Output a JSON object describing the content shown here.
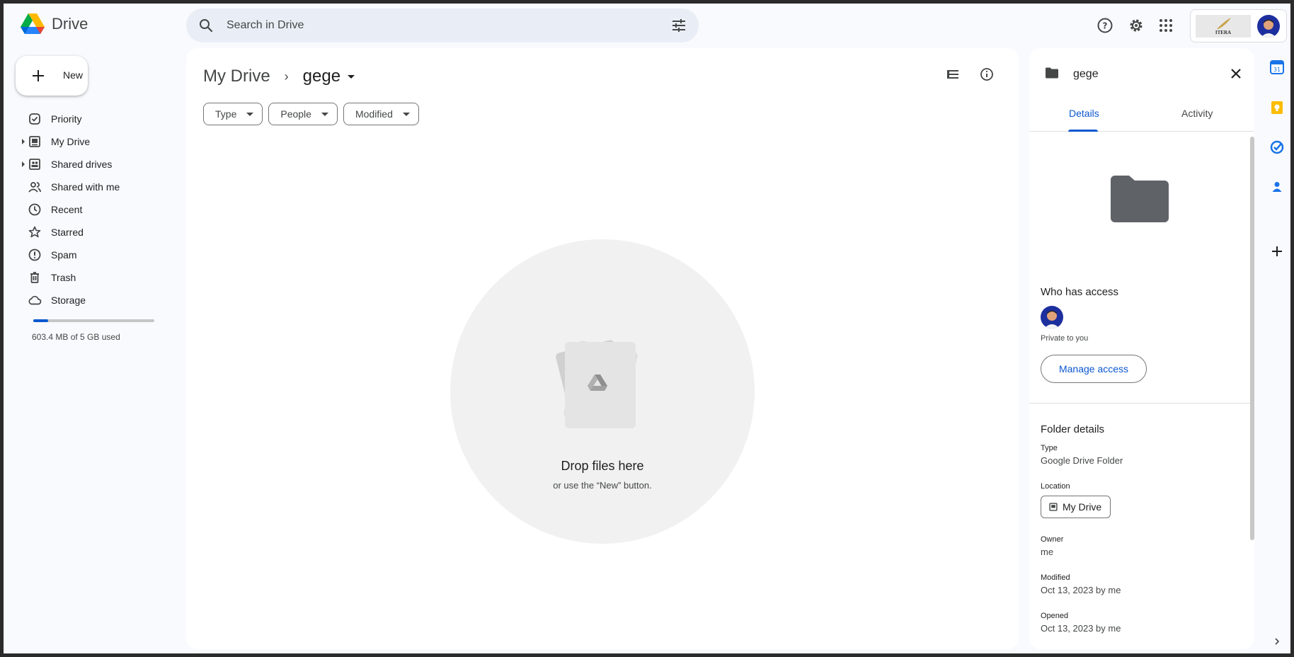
{
  "app": {
    "name": "Drive"
  },
  "search": {
    "placeholder": "Search in Drive"
  },
  "account": {
    "org_label": "ITERA"
  },
  "new_button": {
    "label": "New"
  },
  "nav": {
    "items": [
      {
        "label": "Priority",
        "icon": "priority-icon",
        "expandable": false
      },
      {
        "label": "My Drive",
        "icon": "my-drive-icon",
        "expandable": true
      },
      {
        "label": "Shared drives",
        "icon": "shared-drives-icon",
        "expandable": true
      },
      {
        "label": "Shared with me",
        "icon": "shared-with-me-icon",
        "expandable": false
      },
      {
        "label": "Recent",
        "icon": "clock-icon",
        "expandable": false
      },
      {
        "label": "Starred",
        "icon": "star-icon",
        "expandable": false
      },
      {
        "label": "Spam",
        "icon": "spam-icon",
        "expandable": false
      },
      {
        "label": "Trash",
        "icon": "trash-icon",
        "expandable": false
      },
      {
        "label": "Storage",
        "icon": "cloud-icon",
        "expandable": false
      }
    ],
    "storage_text": "603.4 MB of 5 GB used",
    "storage_fraction": 0.12
  },
  "main": {
    "breadcrumb": {
      "root": "My Drive",
      "current": "gege"
    },
    "filters": [
      "Type",
      "People",
      "Modified"
    ],
    "empty": {
      "title": "Drop files here",
      "subtitle": "or use the “New” button."
    }
  },
  "details": {
    "title": "gege",
    "tabs": [
      "Details",
      "Activity"
    ],
    "active_tab": "Details",
    "access": {
      "heading": "Who has access",
      "status": "Private to you",
      "manage_label": "Manage access"
    },
    "folder": {
      "heading": "Folder details",
      "type_label": "Type",
      "type_value": "Google Drive Folder",
      "location_label": "Location",
      "location_value": "My Drive",
      "owner_label": "Owner",
      "owner_value": "me",
      "modified_label": "Modified",
      "modified_value": "Oct 13, 2023 by me",
      "opened_label": "Opened",
      "opened_value": "Oct 13, 2023 by me"
    }
  },
  "colors": {
    "accent": "#0b57d0",
    "background": "#f8fafd",
    "surface": "#ffffff"
  }
}
